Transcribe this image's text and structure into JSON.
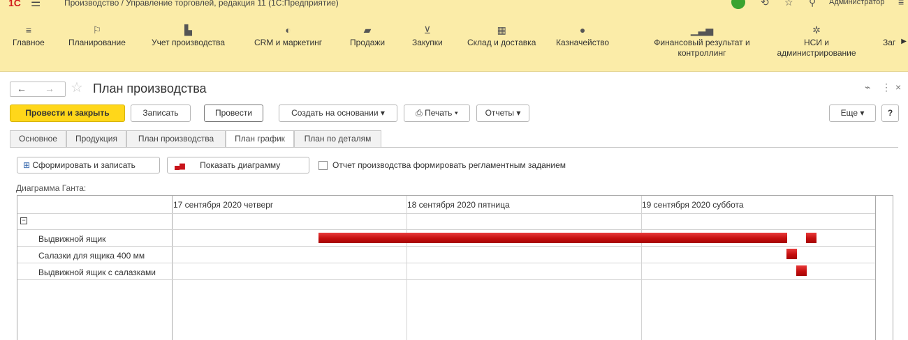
{
  "titlebar": {
    "app_title": "Производство / Управление торговлей, редакция 11  (1С:Предприятие)",
    "user": "Администратор"
  },
  "sections": [
    {
      "label": "Главное",
      "icon": "menu-icon"
    },
    {
      "label": "Планирование",
      "icon": "planning-icon"
    },
    {
      "label": "Учет производства",
      "icon": "factory-icon"
    },
    {
      "label": "CRM и маркетинг",
      "icon": "crm-icon"
    },
    {
      "label": "Продажи",
      "icon": "bag-icon"
    },
    {
      "label": "Закупки",
      "icon": "cart-icon"
    },
    {
      "label": "Склад и доставка",
      "icon": "warehouse-icon"
    },
    {
      "label": "Казначейство",
      "icon": "treasury-icon"
    },
    {
      "label": "Финансовый результат и контроллинг",
      "icon": "chart-icon"
    },
    {
      "label": "НСИ и администрирование",
      "icon": "gear-icon"
    },
    {
      "label": "Заг",
      "icon": ""
    }
  ],
  "form": {
    "title": "План производства"
  },
  "commands": {
    "post_close": "Провести и закрыть",
    "save": "Записать",
    "post": "Провести",
    "create_based": "Создать на основании",
    "print": "Печать",
    "reports": "Отчеты",
    "more": "Еще",
    "help": "?"
  },
  "tabs": [
    "Основное",
    "Продукция",
    "План производства",
    "План график",
    "План по деталям"
  ],
  "active_tab": "План график",
  "schedule_toolbar": {
    "build_save": "Сформировать и записать",
    "show_chart": "Показать диаграмму",
    "checkbox_label": "Отчет производства формировать регламентным заданием",
    "checkbox_checked": false
  },
  "gantt": {
    "label": "Диаграмма Ганта:",
    "dates": [
      "17 сентября 2020 четверг",
      "18 сентября 2020 пятница",
      "19 сентября 2020 суббота"
    ],
    "bar_color": "#c8141a",
    "rows": [
      {
        "name": "Выдвижной ящик"
      },
      {
        "name": "Салазки для ящика 400 мм"
      },
      {
        "name": "Выдвижной ящик с салазками"
      }
    ]
  }
}
